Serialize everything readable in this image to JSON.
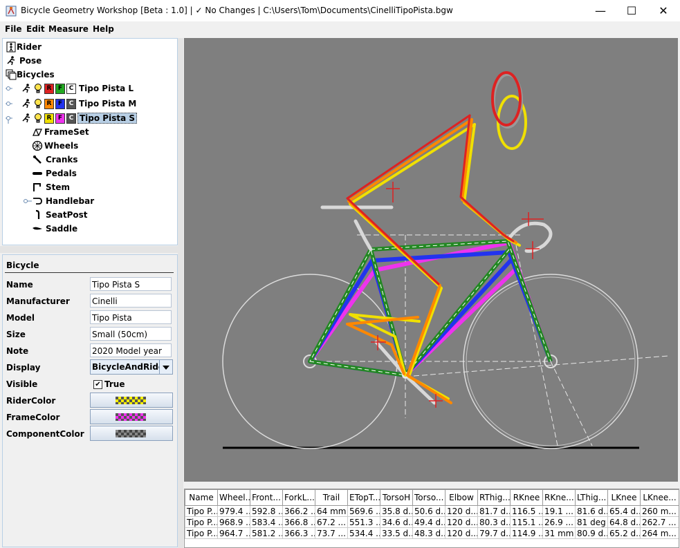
{
  "window": {
    "title": "Bicycle Geometry Workshop [Beta : 1.0]  | ✓ No Changes | C:\\Users\\Tom\\Documents\\CinelliTipoPista.bgw",
    "minimize": "—",
    "maximize": "☐",
    "close": "✕"
  },
  "menu": [
    "File",
    "Edit",
    "Measure",
    "Help"
  ],
  "tree": {
    "rider": "Rider",
    "pose": "Pose",
    "bicycles": "Bicycles",
    "bikes": [
      {
        "label": "Tipo Pista L",
        "badges": [
          "R",
          "F",
          "C"
        ],
        "colors": [
          "#dd2222",
          "#22aa22",
          "#ffffff"
        ]
      },
      {
        "label": "Tipo Pista M",
        "badges": [
          "R",
          "F",
          "C"
        ],
        "colors": [
          "#ff8800",
          "#2233ee",
          "#555555"
        ]
      },
      {
        "label": "Tipo Pista S",
        "badges": [
          "R",
          "F",
          "C"
        ],
        "colors": [
          "#f0e000",
          "#ee33ee",
          "#555555"
        ]
      }
    ],
    "components": [
      "FrameSet",
      "Wheels",
      "Cranks",
      "Pedals",
      "Stem",
      "Handlebar",
      "SeatPost",
      "Saddle"
    ]
  },
  "properties": {
    "title": "Bicycle",
    "name_label": "Name",
    "name_value": "Tipo Pista S",
    "manufacturer_label": "Manufacturer",
    "manufacturer_value": "Cinelli",
    "model_label": "Model",
    "model_value": "Tipo Pista",
    "size_label": "Size",
    "size_value": "Small (50cm)",
    "note_label": "Note",
    "note_value": "2020 Model year",
    "display_label": "Display",
    "display_value": "BicycleAndRider",
    "visible_label": "Visible",
    "visible_value": "True",
    "rider_color_label": "RiderColor",
    "rider_color": "#f5ef00",
    "frame_color_label": "FrameColor",
    "frame_color": "#ee33ee",
    "component_color_label": "ComponentColor",
    "component_color": "#444444"
  },
  "table": {
    "columns": [
      "Name",
      "Wheel...",
      "Front...",
      "ForkL...",
      "Trail",
      "ETopT...",
      "TorsoH",
      "Torso...",
      "Elbow",
      "RThig...",
      "RKnee",
      "RKne...",
      "LThig...",
      "LKnee",
      "LKnee..."
    ],
    "rows": [
      [
        "Tipo P...",
        "979.4 ...",
        "592.8 ...",
        "366.2 ...",
        "64 mm",
        "569.6 ...",
        "35.8 d...",
        "50.6 d...",
        "120 d...",
        "81.7 d...",
        "116.5 ...",
        "19.1 ...",
        "81.6 d...",
        "65.4 d...",
        "260 m..."
      ],
      [
        "Tipo P...",
        "968.9 ...",
        "583.4 ...",
        "366.8 ...",
        "67.2 ...",
        "551.3 ...",
        "34.6 d...",
        "49.4 d...",
        "120 d...",
        "80.3 d...",
        "115.1 ...",
        "26.9 ...",
        "81 deg",
        "64.8 d...",
        "262.7 ..."
      ],
      [
        "Tipo P...",
        "964.7 ...",
        "581.2 ...",
        "366.3 ...",
        "73.7 ...",
        "534.4 ...",
        "33.5 d...",
        "48.3 d...",
        "120 d...",
        "79.7 d...",
        "114.9 ...",
        "31 mm",
        "80.9 d...",
        "65.2 d...",
        "264 m..."
      ]
    ]
  }
}
